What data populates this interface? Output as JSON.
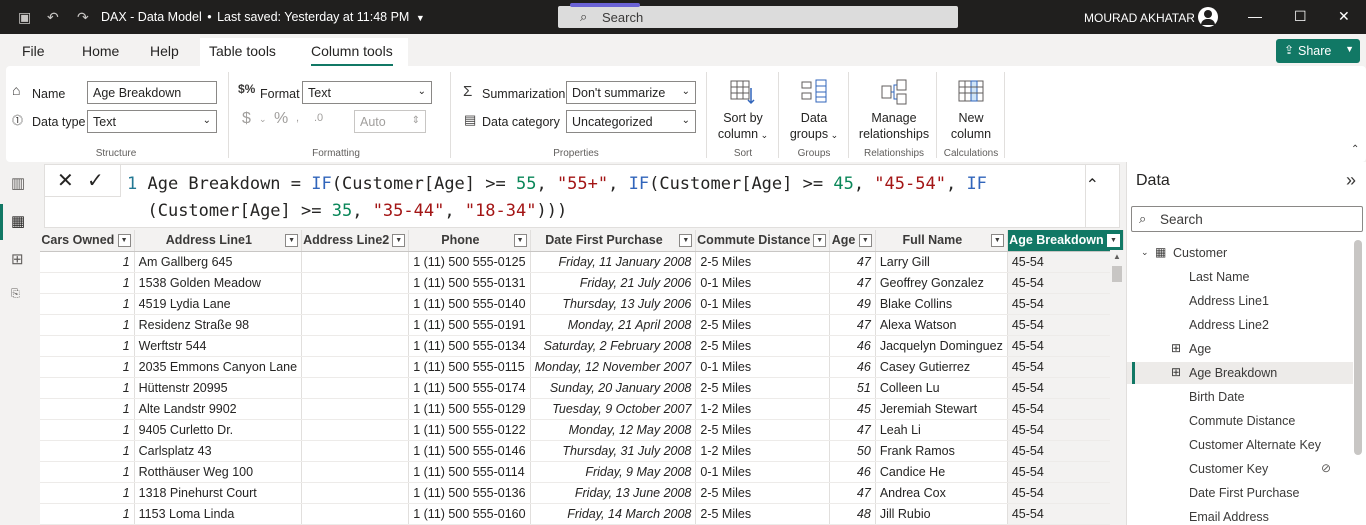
{
  "titlebar": {
    "title": "DAX - Data Model",
    "status": "Last saved: Yesterday at 11:48 PM",
    "search_label": "Search",
    "user": "MOURAD AKHATAR"
  },
  "menubar": {
    "items": [
      "File",
      "Home",
      "Help",
      "Table tools",
      "Column tools"
    ],
    "active": "Column tools",
    "share_label": "Share"
  },
  "ribbon": {
    "structure": {
      "name_label": "Name",
      "name_value": "Age Breakdown",
      "datatype_label": "Data type",
      "datatype_value": "Text",
      "group_title": "Structure"
    },
    "formatting": {
      "format_label": "Format",
      "format_value": "Text",
      "decimals_placeholder": "Auto",
      "group_title": "Formatting",
      "currency_symbol": "$",
      "percent_symbol": "%"
    },
    "properties": {
      "summarization_label": "Summarization",
      "summarization_value": "Don't summarize",
      "category_label": "Data category",
      "category_value": "Uncategorized",
      "group_title": "Properties"
    },
    "sort": {
      "label_line1": "Sort by",
      "label_line2": "column",
      "group_title": "Sort"
    },
    "groups": {
      "label_line1": "Data",
      "label_line2": "groups",
      "group_title": "Groups"
    },
    "relationships": {
      "label_line1": "Manage",
      "label_line2": "relationships",
      "group_title": "Relationships"
    },
    "calculations": {
      "label_line1": "New",
      "label_line2": "column",
      "group_title": "Calculations"
    }
  },
  "formula": {
    "line_number": "1",
    "line1": {
      "prefix": " Age Breakdown = ",
      "fn1": "IF",
      "arg1": "(Customer[Age] >= ",
      "num1": "55",
      "sep1": ", ",
      "str1": "\"55+\"",
      "sep2": ", ",
      "fn2": "IF",
      "arg2": "(Customer[Age] >= ",
      "num2": "45",
      "sep3": ", ",
      "str2": "\"45-54\"",
      "sep4": ", ",
      "fn3": "IF"
    },
    "line2": {
      "arg3": "(Customer[Age] >= ",
      "num3": "35",
      "sep5": ", ",
      "str3": "\"35-44\"",
      "sep6": ", ",
      "str4": "\"18-34\"",
      "close": ")))"
    }
  },
  "table": {
    "columns": [
      "Cars Owned",
      "Address Line1",
      "Address Line2",
      "Phone",
      "Date First Purchase",
      "Commute Distance",
      "Age",
      "Full Name",
      "Age Breakdown"
    ],
    "selected_column": "Age Breakdown",
    "rows": [
      [
        "1",
        "Am Gallberg 645",
        "",
        "1 (11) 500 555-0125",
        "Friday, 11 January 2008",
        "2-5 Miles",
        "47",
        "Larry Gill",
        "45-54"
      ],
      [
        "1",
        "1538 Golden Meadow",
        "",
        "1 (11) 500 555-0131",
        "Friday, 21 July 2006",
        "0-1 Miles",
        "47",
        "Geoffrey Gonzalez",
        "45-54"
      ],
      [
        "1",
        "4519 Lydia Lane",
        "",
        "1 (11) 500 555-0140",
        "Thursday, 13 July 2006",
        "0-1 Miles",
        "49",
        "Blake Collins",
        "45-54"
      ],
      [
        "1",
        "Residenz Straße 98",
        "",
        "1 (11) 500 555-0191",
        "Monday, 21 April 2008",
        "2-5 Miles",
        "47",
        "Alexa Watson",
        "45-54"
      ],
      [
        "1",
        "Werftstr 544",
        "",
        "1 (11) 500 555-0134",
        "Saturday, 2 February 2008",
        "2-5 Miles",
        "46",
        "Jacquelyn Dominguez",
        "45-54"
      ],
      [
        "1",
        "2035 Emmons Canyon Lane",
        "",
        "1 (11) 500 555-0115",
        "Monday, 12 November 2007",
        "0-1 Miles",
        "46",
        "Casey Gutierrez",
        "45-54"
      ],
      [
        "1",
        "Hüttenstr 20995",
        "",
        "1 (11) 500 555-0174",
        "Sunday, 20 January 2008",
        "2-5 Miles",
        "51",
        "Colleen Lu",
        "45-54"
      ],
      [
        "1",
        "Alte Landstr 9902",
        "",
        "1 (11) 500 555-0129",
        "Tuesday, 9 October 2007",
        "1-2 Miles",
        "45",
        "Jeremiah Stewart",
        "45-54"
      ],
      [
        "1",
        "9405 Curletto Dr.",
        "",
        "1 (11) 500 555-0122",
        "Monday, 12 May 2008",
        "2-5 Miles",
        "47",
        "Leah Li",
        "45-54"
      ],
      [
        "1",
        "Carlsplatz 43",
        "",
        "1 (11) 500 555-0146",
        "Thursday, 31 July 2008",
        "1-2 Miles",
        "50",
        "Frank Ramos",
        "45-54"
      ],
      [
        "1",
        "Rotthäuser Weg 100",
        "",
        "1 (11) 500 555-0114",
        "Friday, 9 May 2008",
        "0-1 Miles",
        "46",
        "Candice He",
        "45-54"
      ],
      [
        "1",
        "1318 Pinehurst Court",
        "",
        "1 (11) 500 555-0136",
        "Friday, 13 June 2008",
        "2-5 Miles",
        "47",
        "Andrea Cox",
        "45-54"
      ],
      [
        "1",
        "1153 Loma Linda",
        "",
        "1 (11) 500 555-0160",
        "Friday, 14 March 2008",
        "2-5 Miles",
        "48",
        "Jill Rubio",
        "45-54"
      ]
    ]
  },
  "datapane": {
    "title": "Data",
    "search_placeholder": "Search",
    "table_name": "Customer",
    "fields": [
      {
        "label": "Last Name",
        "icon": "none",
        "hidden": false
      },
      {
        "label": "Address Line1",
        "icon": "none",
        "hidden": false
      },
      {
        "label": "Address Line2",
        "icon": "none",
        "hidden": false
      },
      {
        "label": "Age",
        "icon": "calculated-column-icon",
        "hidden": false
      },
      {
        "label": "Age Breakdown",
        "icon": "calculated-column-icon",
        "hidden": false,
        "selected": true
      },
      {
        "label": "Birth Date",
        "icon": "none",
        "hidden": false
      },
      {
        "label": "Commute Distance",
        "icon": "none",
        "hidden": false
      },
      {
        "label": "Customer Alternate Key",
        "icon": "none",
        "hidden": false
      },
      {
        "label": "Customer Key",
        "icon": "none",
        "hidden": true
      },
      {
        "label": "Date First Purchase",
        "icon": "none",
        "hidden": false
      },
      {
        "label": "Email Address",
        "icon": "none",
        "hidden": false
      }
    ]
  },
  "colors": {
    "accent": "#117865",
    "titlebar": "#201f1e",
    "code_function": "#3165bb",
    "code_number": "#098658",
    "code_string": "#a31515"
  }
}
